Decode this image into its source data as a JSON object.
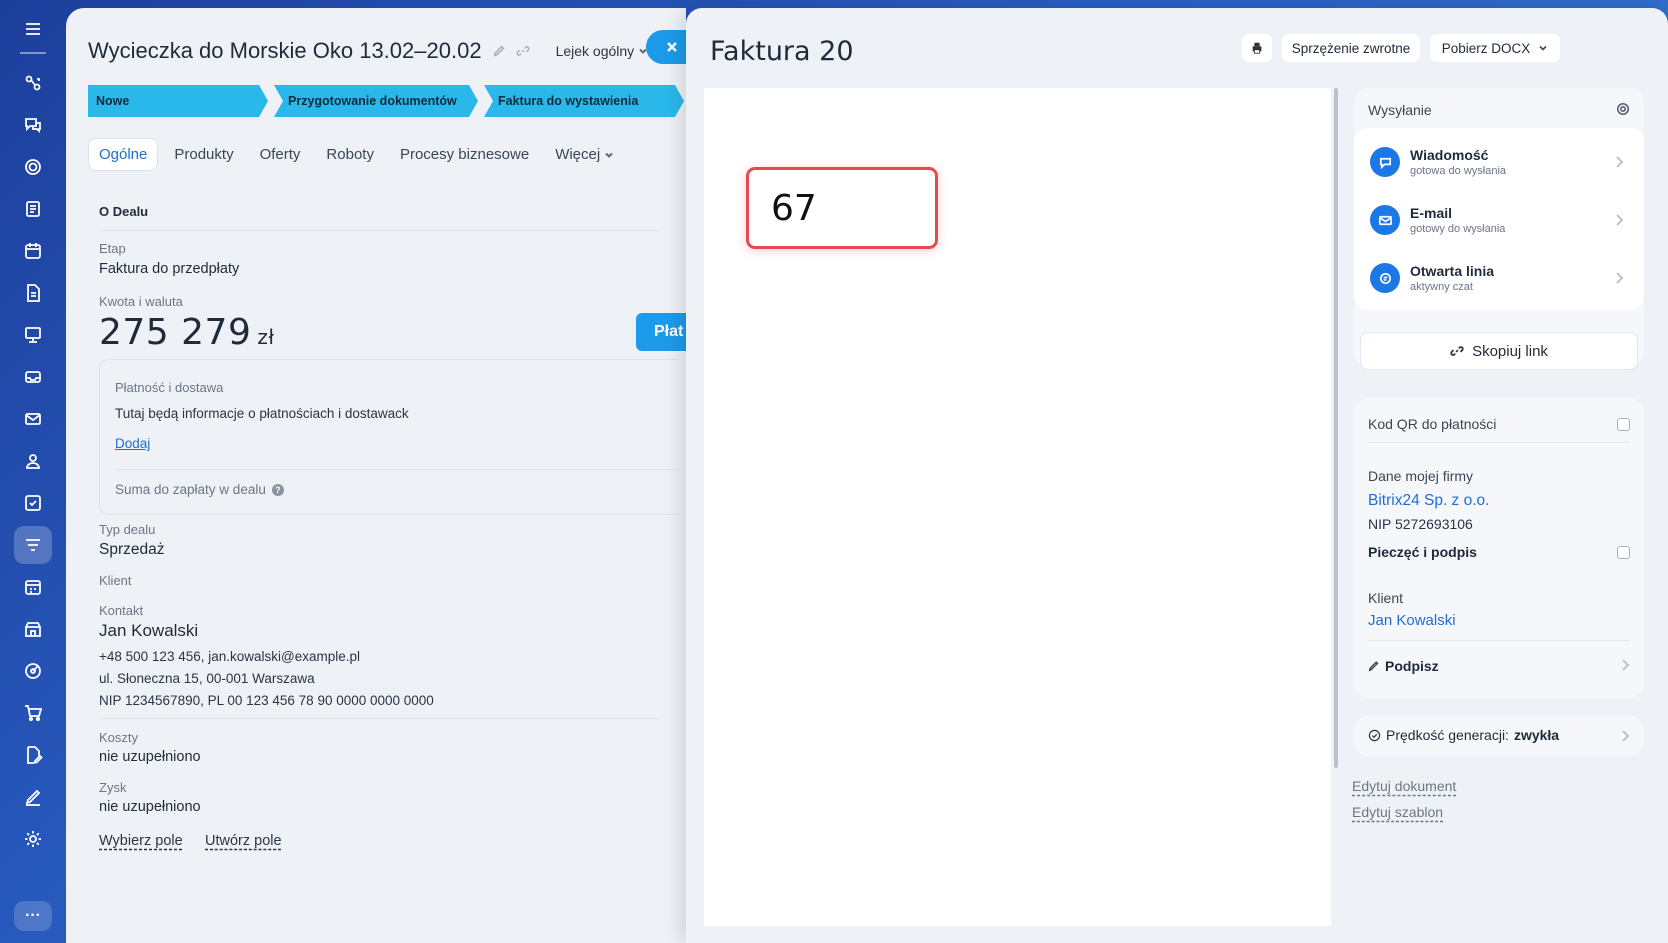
{
  "deal": {
    "title": "Wycieczka do Morskie Oko 13.02–20.02",
    "funnel": "Lejek ogólny",
    "stages": [
      "Nowe",
      "Przygotowanie dokumentów",
      "Faktura do wystawienia"
    ],
    "tabs": [
      "Ogólne",
      "Produkty",
      "Oferty",
      "Roboty",
      "Procesy biznesowe",
      "Więcej"
    ],
    "section_title": "O Dealu",
    "stage_label": "Etap",
    "stage_value": "Faktura do przedpłaty",
    "amount_label": "Kwota i waluta",
    "amount_value": "275 279",
    "amount_currency": "zł",
    "pay_button": "Płat",
    "payment": {
      "title": "Płatność i dostawa",
      "text": "Tutaj będą informacje o płatnościach i dostawack",
      "add": "Dodaj",
      "sum": "Suma do zapłaty w dealu"
    },
    "deal_type_label": "Typ dealu",
    "deal_type_value": "Sprzedaż",
    "client_label": "Klient",
    "contact_label": "Kontakt",
    "contact_name": "Jan Kowalski",
    "contact_line1": "+48 500 123 456, jan.kowalski@example.pl",
    "contact_line2": "ul. Słoneczna 15, 00-001 Warszawa",
    "contact_line3": "NIP 1234567890, PL 00 123 456 78 90 0000 0000 0000",
    "costs_label": "Koszty",
    "costs_value": "nie uzupełniono",
    "profit_label": "Zysk",
    "profit_value": "nie uzupełniono",
    "choose_field": "Wybierz pole",
    "create_field": "Utwórz pole"
  },
  "invoice": {
    "title": "Faktura 20",
    "feedback": "Sprzężenie zwrotne",
    "download": "Pobierz DOCX",
    "highlight_number": "67"
  },
  "sidebar": {
    "sending_title": "Wysyłanie",
    "channels": [
      {
        "name": "Wiadomość",
        "sub": "gotowa do wysłania",
        "icon": "chat-icon"
      },
      {
        "name": "E-mail",
        "sub": "gotowy do wysłania",
        "icon": "mail-icon"
      },
      {
        "name": "Otwarta linia",
        "sub": "aktywny czat",
        "icon": "openline-icon"
      }
    ],
    "copy_link": "Skopiuj link",
    "qr_label": "Kod QR do płatności",
    "company_label": "Dane mojej firmy",
    "company_name": "Bitrix24 Sp. z o.o.",
    "company_nip": "NIP 5272693106",
    "seal_label": "Pieczęć i podpis",
    "client_label": "Klient",
    "client_name": "Jan Kowalski",
    "sign_label": "Podpisz",
    "speed_prefix": "Prędkość generacji:",
    "speed_value": "zwykła",
    "edit_document": "Edytuj dokument",
    "edit_template": "Edytuj szablon"
  },
  "colors": {
    "accent": "#1c9bea",
    "stage": "#2ab8ea",
    "link": "#1d6fd3",
    "highlight_border": "#e8484f"
  }
}
